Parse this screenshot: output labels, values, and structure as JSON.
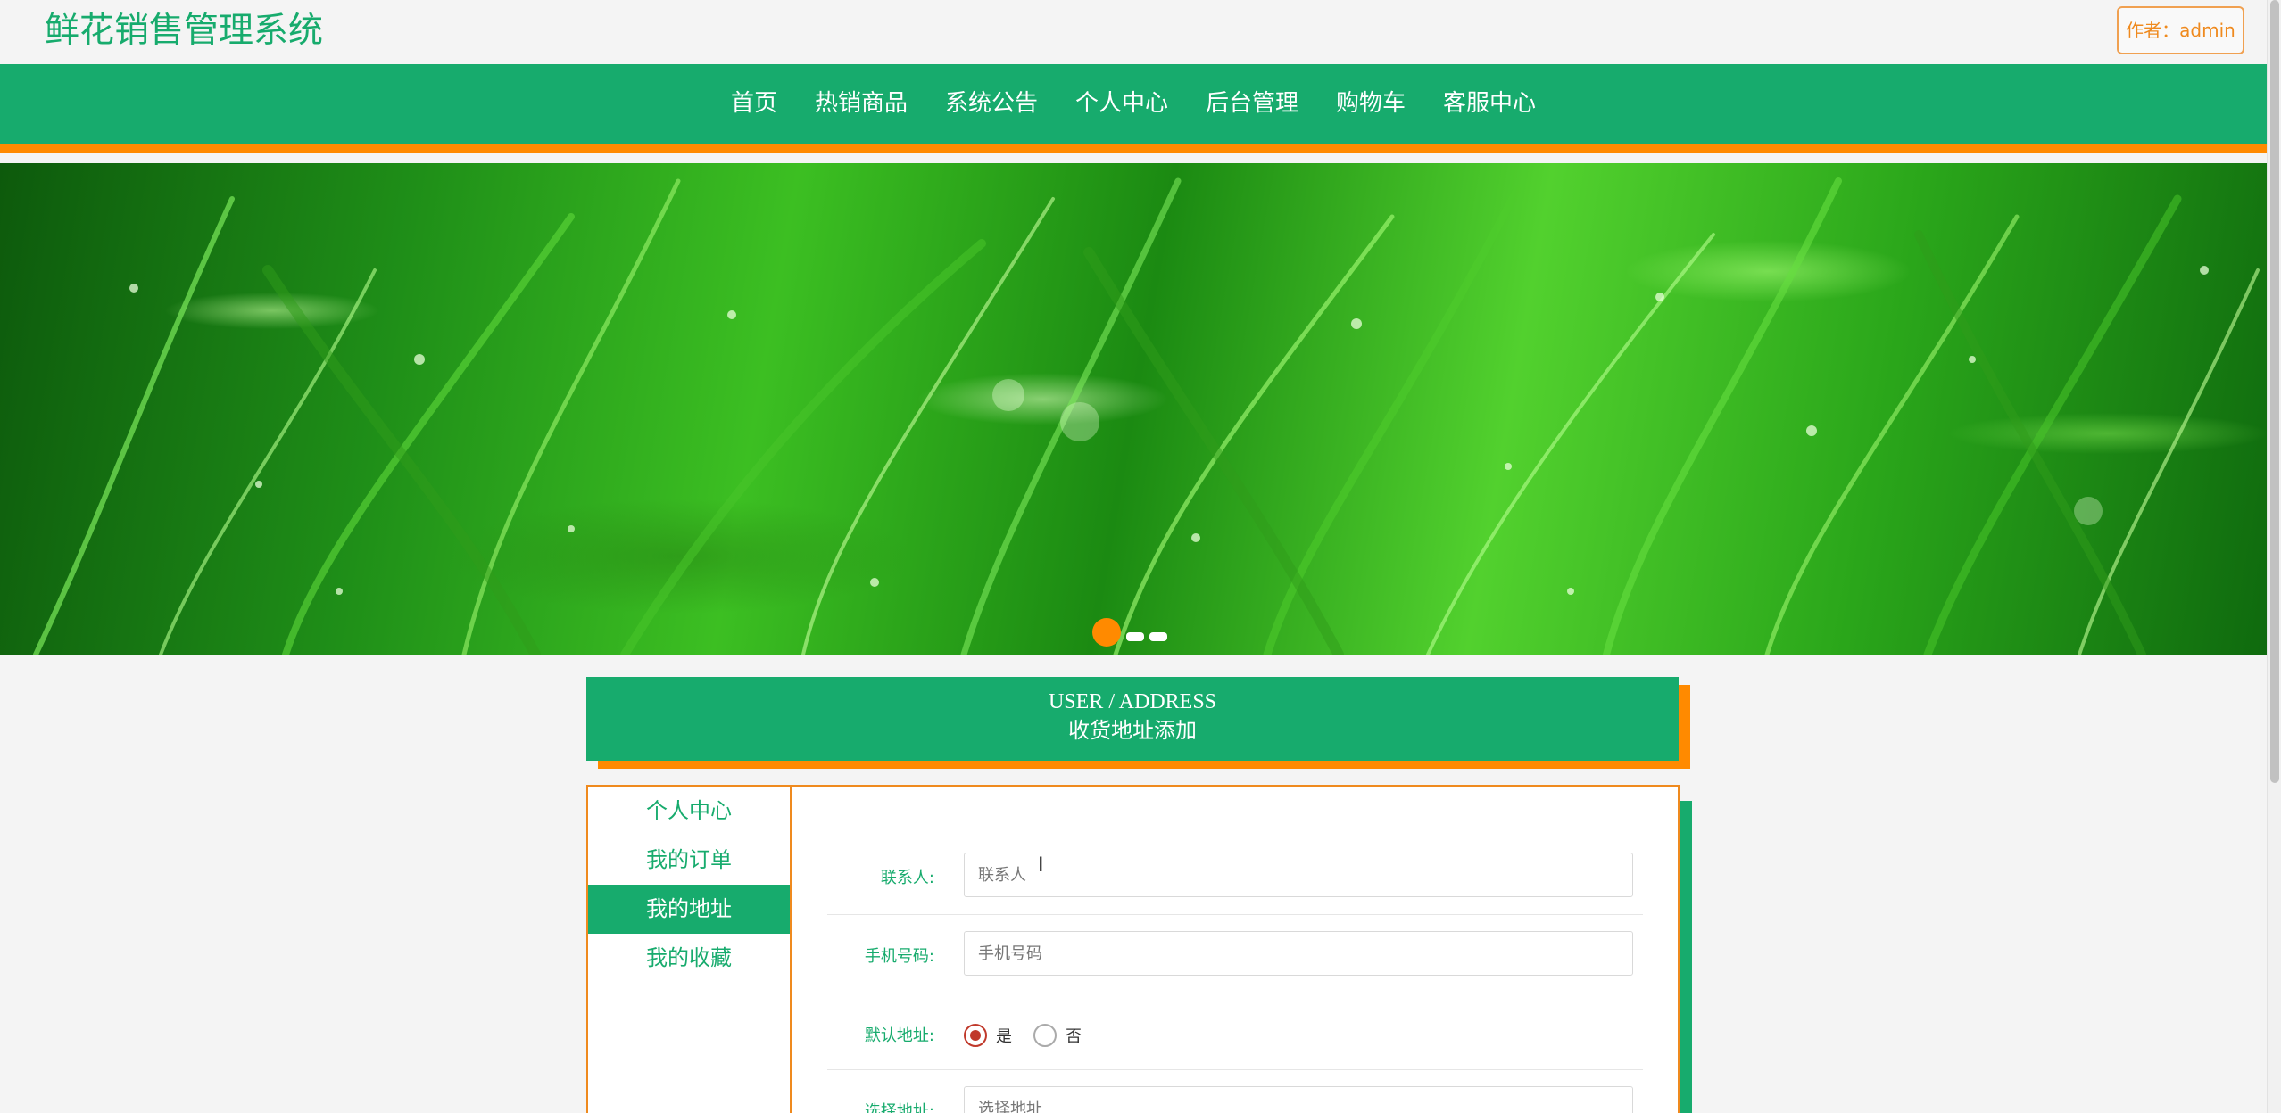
{
  "header": {
    "site_title": "鲜花销售管理系统",
    "author_label": "作者：admin"
  },
  "nav": {
    "items": [
      "首页",
      "热销商品",
      "系统公告",
      "个人中心",
      "后台管理",
      "购物车",
      "客服中心"
    ]
  },
  "banner": {
    "slides_count": 3,
    "active_slide": 1
  },
  "section": {
    "title_en": "USER / ADDRESS",
    "title_cn": "收货地址添加"
  },
  "sidebar": {
    "items": [
      {
        "label": "个人中心",
        "active": false
      },
      {
        "label": "我的订单",
        "active": false
      },
      {
        "label": "我的地址",
        "active": true
      },
      {
        "label": "我的收藏",
        "active": false
      }
    ]
  },
  "form": {
    "contact": {
      "label": "联系人:",
      "placeholder": "联系人",
      "value": ""
    },
    "phone": {
      "label": "手机号码:",
      "placeholder": "手机号码",
      "value": ""
    },
    "default": {
      "label": "默认地址:",
      "options": [
        "是",
        "否"
      ],
      "selected": "是"
    },
    "address": {
      "label": "选择地址:",
      "placeholder": "选择地址",
      "value": ""
    }
  },
  "colors": {
    "primary": "#17ab6d",
    "accent": "#ff8a00",
    "radio_checked": "#c0392b"
  }
}
